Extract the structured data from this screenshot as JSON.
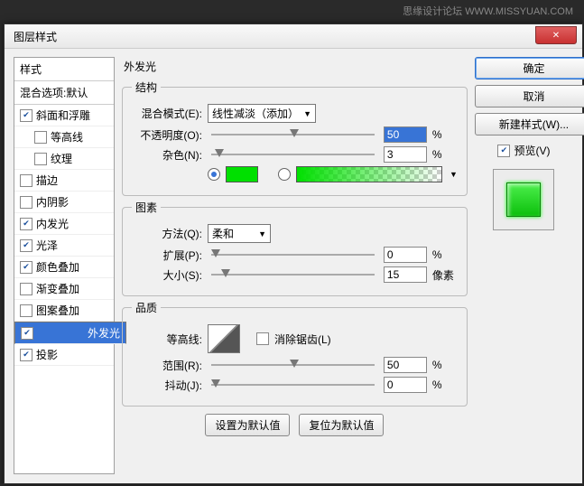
{
  "watermark": "思缘设计论坛 WWW.MISSYUAN.COM",
  "dialog_title": "图层样式",
  "close_x": "✕",
  "styles": {
    "header": "样式",
    "blend_options": "混合选项:默认",
    "items": [
      {
        "label": "斜面和浮雕",
        "checked": true,
        "indent": false
      },
      {
        "label": "等高线",
        "checked": false,
        "indent": true
      },
      {
        "label": "纹理",
        "checked": false,
        "indent": true
      },
      {
        "label": "描边",
        "checked": false,
        "indent": false
      },
      {
        "label": "内阴影",
        "checked": false,
        "indent": false
      },
      {
        "label": "内发光",
        "checked": true,
        "indent": false
      },
      {
        "label": "光泽",
        "checked": true,
        "indent": false
      },
      {
        "label": "颜色叠加",
        "checked": true,
        "indent": false
      },
      {
        "label": "渐变叠加",
        "checked": false,
        "indent": false
      },
      {
        "label": "图案叠加",
        "checked": false,
        "indent": false
      },
      {
        "label": "外发光",
        "checked": true,
        "indent": false,
        "selected": true
      },
      {
        "label": "投影",
        "checked": true,
        "indent": false
      }
    ]
  },
  "panel_title": "外发光",
  "groups": {
    "structure": {
      "legend": "结构",
      "blend_mode_label": "混合模式(E):",
      "blend_mode_value": "线性减淡（添加）",
      "opacity_label": "不透明度(O):",
      "opacity_value": "50",
      "opacity_unit": "%",
      "noise_label": "杂色(N):",
      "noise_value": "3",
      "noise_unit": "%"
    },
    "elements": {
      "legend": "图素",
      "technique_label": "方法(Q):",
      "technique_value": "柔和",
      "spread_label": "扩展(P):",
      "spread_value": "0",
      "spread_unit": "%",
      "size_label": "大小(S):",
      "size_value": "15",
      "size_unit": "像素"
    },
    "quality": {
      "legend": "品质",
      "contour_label": "等高线:",
      "antialias_label": "消除锯齿(L)",
      "range_label": "范围(R):",
      "range_value": "50",
      "range_unit": "%",
      "jitter_label": "抖动(J):",
      "jitter_value": "0",
      "jitter_unit": "%"
    }
  },
  "bottom": {
    "default": "设置为默认值",
    "reset": "复位为默认值"
  },
  "right": {
    "ok": "确定",
    "cancel": "取消",
    "new_style": "新建样式(W)...",
    "preview": "预览(V)"
  }
}
